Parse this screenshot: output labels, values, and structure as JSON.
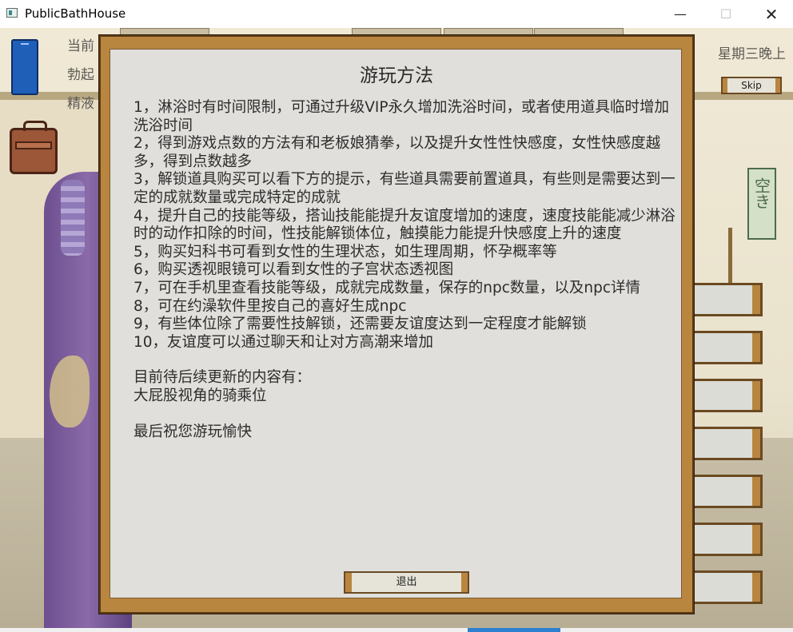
{
  "window": {
    "title": "PublicBathHouse",
    "minimize_glyph": "—",
    "maximize_glyph": "☐",
    "close_glyph": "✕"
  },
  "scene": {
    "partial_text": [
      "当前",
      "勃起",
      "精液"
    ],
    "day_text": "星期三晚上",
    "skip_label": "Skip",
    "sign_text": "空き"
  },
  "dialog": {
    "title": "游玩方法",
    "rules": [
      "1，淋浴时有时间限制，可通过升级VIP永久增加洗浴时间，或者使用道具临时增加洗浴时间",
      "2，得到游戏点数的方法有和老板娘猜拳，以及提升女性性快感度，女性快感度越多，得到点数越多",
      "3，解锁道具购买可以看下方的提示，有些道具需要前置道具，有些则是需要达到一定的成就数量或完成特定的成就",
      "4，提升自己的技能等级，搭讪技能能提升友谊度增加的速度，速度技能能减少淋浴时的动作扣除的时间，性技能解锁体位，触摸能力能提升快感度上升的速度",
      "5，购买妇科书可看到女性的生理状态，如生理周期，怀孕概率等",
      "6，购买透视眼镜可以看到女性的子宫状态透视图",
      "7，可在手机里查看技能等级，成就完成数量，保存的npc数量，以及npc详情",
      "8，可在约澡软件里按自己的喜好生成npc",
      "9，有些体位除了需要性技解锁，还需要友谊度达到一定程度才能解锁",
      "10，友谊度可以通过聊天和让对方高潮来增加"
    ],
    "update_heading": "目前待后续更新的内容有：",
    "update_item": "大屁股视角的骑乘位",
    "farewell": "最后祝您游玩愉快",
    "exit_label": "退出"
  },
  "colors": {
    "frame_wood": "#b98640",
    "panel_bg": "#e0dfdb",
    "text": "#2d2d2d"
  }
}
